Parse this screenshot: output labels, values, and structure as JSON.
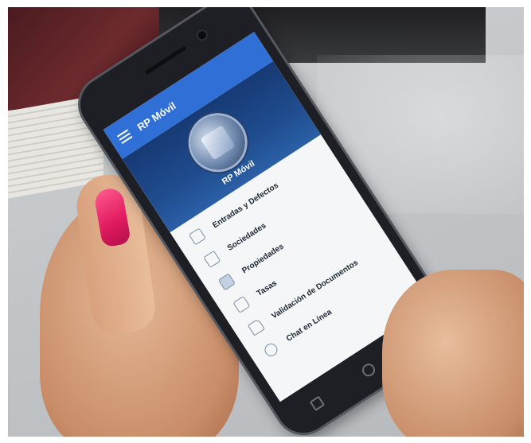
{
  "app": {
    "title": "RP Móvil"
  },
  "drawer": {
    "header_title": "RP Móvil",
    "items": [
      {
        "label": "Entradas y Defectos",
        "icon": "folder-icon"
      },
      {
        "label": "Sociedades",
        "icon": "folder-icon"
      },
      {
        "label": "Propiedades",
        "icon": "folder-icon"
      },
      {
        "label": "Tasas",
        "icon": "folder-icon"
      },
      {
        "label": "Validación de Documentos",
        "icon": "document-icon"
      },
      {
        "label": "Chat en Línea",
        "icon": "chat-icon"
      }
    ]
  },
  "colors": {
    "appbar": "#2f6fd6",
    "drawer_header": "#1f4c8e",
    "nail": "#e0195f"
  }
}
